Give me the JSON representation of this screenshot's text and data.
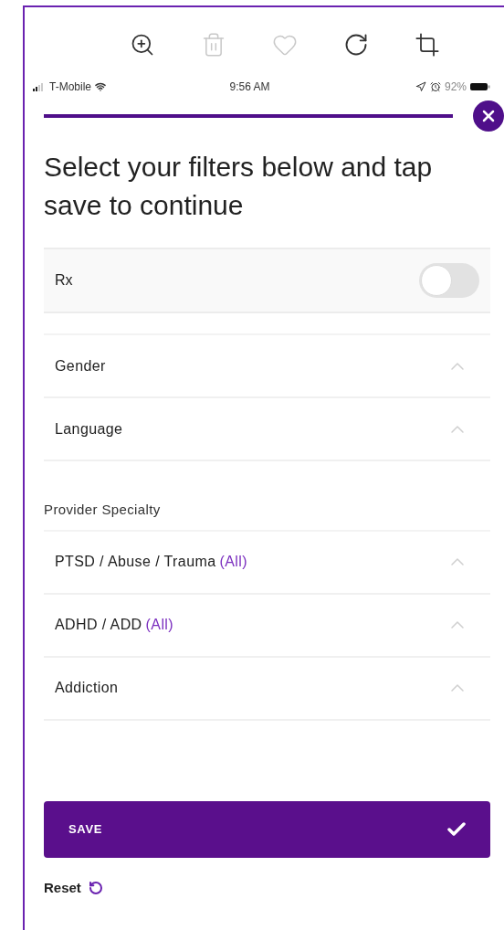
{
  "status_bar": {
    "carrier": "T-Mobile",
    "time": "9:56 AM",
    "battery": "92%"
  },
  "heading": "Select your filters below and tap save to continue",
  "rx": {
    "label": "Rx",
    "on": false
  },
  "filters": [
    {
      "label": "Gender"
    },
    {
      "label": "Language"
    }
  ],
  "specialty": {
    "title": "Provider Specialty",
    "items": [
      {
        "label": "PTSD / Abuse / Trauma",
        "badge": "(All)"
      },
      {
        "label": "ADHD / ADD",
        "badge": "(All)"
      },
      {
        "label": "Addiction"
      }
    ]
  },
  "save_button": "SAVE",
  "reset": "Reset"
}
